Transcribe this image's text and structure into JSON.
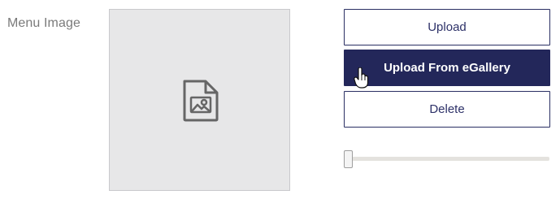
{
  "form": {
    "label": "Menu Image"
  },
  "image": {
    "placeholder_icon": "image-file-icon"
  },
  "buttons": {
    "upload_label": "Upload",
    "egallery_label": "Upload From eGallery",
    "delete_label": "Delete"
  },
  "slider": {
    "value": 0
  },
  "colors": {
    "primary": "#23275a",
    "button_border": "#2a2f63",
    "image_bg": "#e7e7e8",
    "label_text": "#7a7a7a"
  }
}
